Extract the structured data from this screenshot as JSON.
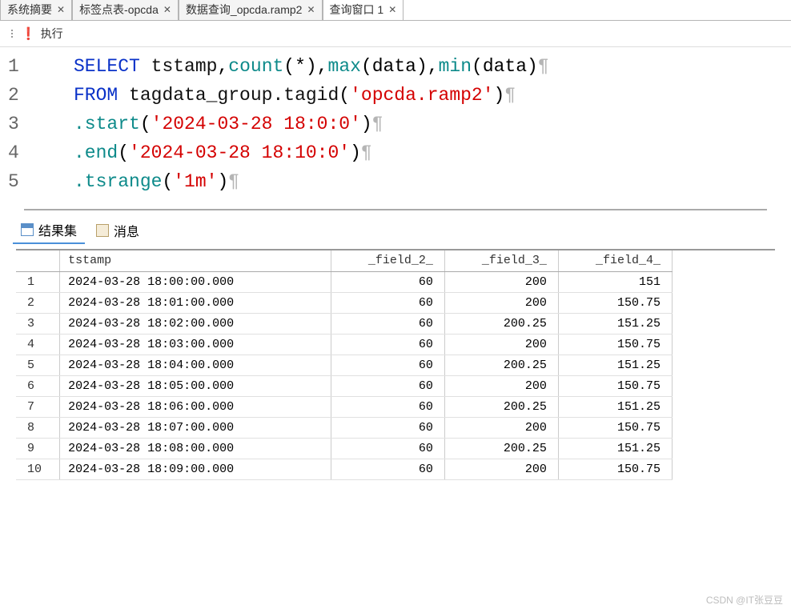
{
  "tabs": [
    {
      "label": "系统摘要"
    },
    {
      "label": "标签点表-opcda"
    },
    {
      "label": "数据查询_opcda.ramp2"
    },
    {
      "label": "查询窗口 1"
    }
  ],
  "toolbar": {
    "execute": "执行"
  },
  "code": {
    "lines": [
      "1",
      "2",
      "3",
      "4",
      "5"
    ],
    "kw_select": "SELECT",
    "c_tstamp": "tstamp",
    "c_count": "count",
    "c_star": "(*)",
    "c_max": "max",
    "c_data_open": "(data)",
    "c_min": "min",
    "kw_from": "FROM",
    "c_tagdata": "tagdata_group.tagid",
    "s_tag": "'opcda.ramp2'",
    "c_start": ".start",
    "s_start": "'2024-03-28 18:0:0'",
    "c_end": ".end",
    "s_end": "'2024-03-28 18:10:0'",
    "c_tsrange": ".tsrange",
    "s_tsrange": "'1m'",
    "comma": ",",
    "lp": "(",
    "rp": ")",
    "para": "¶"
  },
  "resultTabs": {
    "results": "结果集",
    "messages": "消息"
  },
  "table": {
    "headers": {
      "tstamp": "tstamp",
      "f2": "_field_2_",
      "f3": "_field_3_",
      "f4": "_field_4_"
    },
    "rows": [
      {
        "n": "1",
        "tstamp": "2024-03-28 18:00:00.000",
        "f2": "60",
        "f3": "200",
        "f4": "151"
      },
      {
        "n": "2",
        "tstamp": "2024-03-28 18:01:00.000",
        "f2": "60",
        "f3": "200",
        "f4": "150.75"
      },
      {
        "n": "3",
        "tstamp": "2024-03-28 18:02:00.000",
        "f2": "60",
        "f3": "200.25",
        "f4": "151.25"
      },
      {
        "n": "4",
        "tstamp": "2024-03-28 18:03:00.000",
        "f2": "60",
        "f3": "200",
        "f4": "150.75"
      },
      {
        "n": "5",
        "tstamp": "2024-03-28 18:04:00.000",
        "f2": "60",
        "f3": "200.25",
        "f4": "151.25"
      },
      {
        "n": "6",
        "tstamp": "2024-03-28 18:05:00.000",
        "f2": "60",
        "f3": "200",
        "f4": "150.75"
      },
      {
        "n": "7",
        "tstamp": "2024-03-28 18:06:00.000",
        "f2": "60",
        "f3": "200.25",
        "f4": "151.25"
      },
      {
        "n": "8",
        "tstamp": "2024-03-28 18:07:00.000",
        "f2": "60",
        "f3": "200",
        "f4": "150.75"
      },
      {
        "n": "9",
        "tstamp": "2024-03-28 18:08:00.000",
        "f2": "60",
        "f3": "200.25",
        "f4": "151.25"
      },
      {
        "n": "10",
        "tstamp": "2024-03-28 18:09:00.000",
        "f2": "60",
        "f3": "200",
        "f4": "150.75"
      }
    ]
  },
  "watermark": "CSDN @IT张豆豆"
}
